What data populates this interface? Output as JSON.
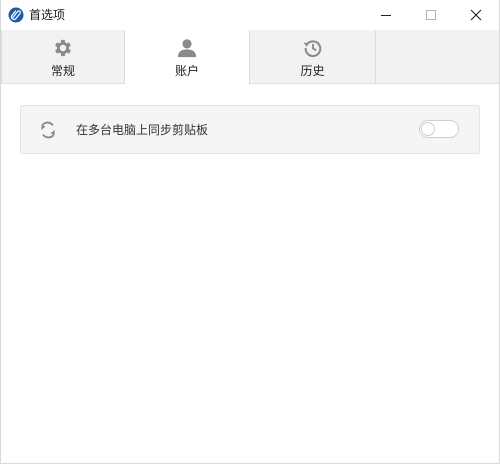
{
  "window": {
    "title": "首选项",
    "app_icon": "clipboard-app-icon",
    "controls": {
      "minimize_icon": "minimize-icon",
      "maximize_icon": "maximize-icon",
      "close_icon": "close-icon"
    }
  },
  "tabs": [
    {
      "label": "常规",
      "icon": "gear-icon",
      "selected": false
    },
    {
      "label": "账户",
      "icon": "user-icon",
      "selected": true
    },
    {
      "label": "历史",
      "icon": "history-icon",
      "selected": false
    }
  ],
  "settings": {
    "sync_clipboard": {
      "icon": "sync-icon",
      "label": "在多台电脑上同步剪贴板",
      "enabled": false
    }
  },
  "colors": {
    "icon_gray": "#8a8a8a",
    "tab_bar_bg": "#f2f2f2",
    "selected_tab_bg": "#ffffff",
    "row_bg": "#f5f5f5",
    "app_icon_blue": "#1e5aa8"
  }
}
